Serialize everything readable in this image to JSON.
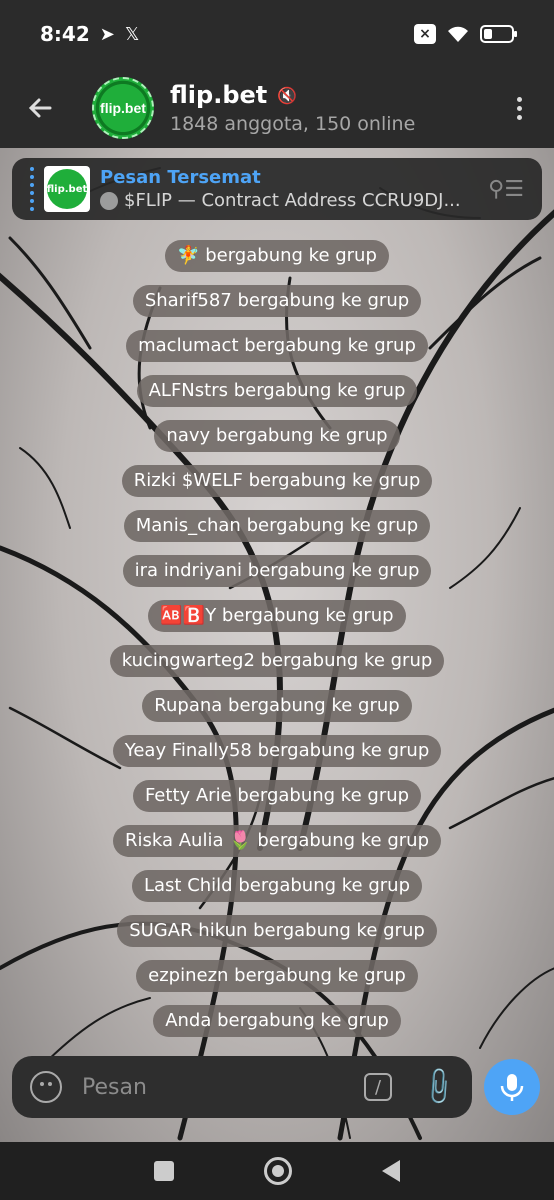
{
  "statusbar": {
    "time": "8:42",
    "icons": [
      "telegram-icon",
      "x-icon",
      "notification-x-icon",
      "wifi-icon",
      "battery-icon"
    ]
  },
  "header": {
    "title": "flip.bet",
    "subtitle": "1848 anggota, 150 online",
    "avatar_text": "flip.bet",
    "muted": true
  },
  "pinned": {
    "label": "Pesan Tersemat",
    "text": "$FLIP — Contract Address  CCRU9DJ..."
  },
  "service_messages": [
    "🧚 bergabung ke grup",
    "Sharif587 bergabung ke grup",
    "maclumact bergabung ke grup",
    "ALFNstrs bergabung ke grup",
    "navy bergabung ke grup",
    "Rizki $WELF bergabung ke grup",
    "Manis_chan bergabung ke grup",
    "ira indriyani bergabung ke grup",
    "🆎🅱️Y bergabung ke grup",
    "kucingwarteg2 bergabung ke grup",
    "Rupana bergabung ke grup",
    "Yeay Finally58 bergabung ke grup",
    "Fetty Arie bergabung ke grup",
    "Riska Aulia 🌷 bergabung ke grup",
    "Last Child bergabung ke grup",
    "SUGAR hikun bergabung ke grup",
    "ezpinezn bergabung ke grup",
    "Anda bergabung ke grup"
  ],
  "composer": {
    "placeholder": "Pesan"
  },
  "colors": {
    "accent": "#4ea4f6",
    "bar_bg": "#2b2b2b",
    "service_bg": "#6e6864",
    "logo_green": "#1fae3a"
  }
}
